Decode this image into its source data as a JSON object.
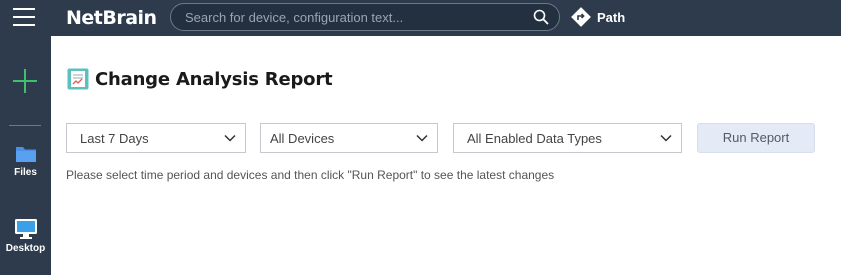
{
  "header": {
    "logo_text": "NetBrain",
    "search_placeholder": "Search for device, configuration text...",
    "path_label": "Path"
  },
  "sidebar": {
    "items": [
      {
        "label": "Files",
        "icon": "folder-icon"
      },
      {
        "label": "Desktop",
        "icon": "monitor-icon"
      }
    ]
  },
  "main": {
    "title": "Change Analysis Report",
    "filters": {
      "time_period": "Last 7 Days",
      "devices": "All Devices",
      "data_types": "All Enabled Data Types"
    },
    "run_button_label": "Run Report",
    "hint": "Please select time period and devices and then click \"Run Report\" to see the latest changes"
  },
  "colors": {
    "topbar_bg": "#2d3b4d",
    "accent_green": "#3fbf6f",
    "folder_blue": "#4a90e2",
    "run_button_bg": "#e4ebf6"
  }
}
